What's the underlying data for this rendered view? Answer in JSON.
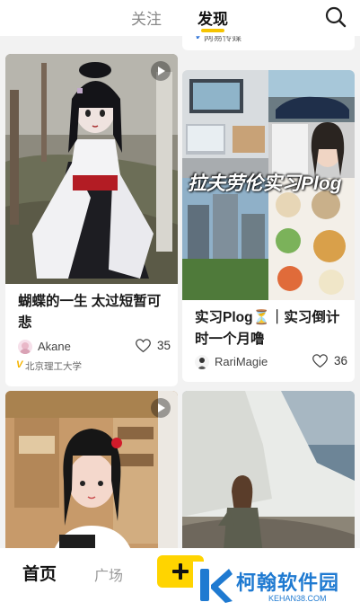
{
  "topbar": {
    "tab_follow": "关注",
    "tab_discover": "发现"
  },
  "feed": {
    "cards": [
      {
        "title": "",
        "author": "",
        "likes": "",
        "org": "网易传媒",
        "has_video": false
      },
      {
        "title": "蝴蝶的一生 太过短暂可悲",
        "author": "Akane",
        "likes": "35",
        "org": "北京理工大学",
        "has_video": true
      },
      {
        "title": "实习Plog⏳｜实习倒计时一个月噜",
        "author": "RariMagie",
        "likes": "36",
        "overlay_text": "拉夫劳伦实习Plog",
        "has_video": false
      },
      {
        "title": "",
        "author": "",
        "likes": "",
        "has_video": true
      },
      {
        "title": "",
        "author": "",
        "likes": "",
        "has_video": false
      }
    ]
  },
  "bottombar": {
    "home": "首页",
    "square": "广场"
  },
  "watermark": {
    "name": "柯翰软件园",
    "url": "KEHAN38.COM"
  },
  "colors": {
    "accent": "#f5c400",
    "post_button": "#ffd400",
    "watermark_blue": "#1f7ad1"
  }
}
